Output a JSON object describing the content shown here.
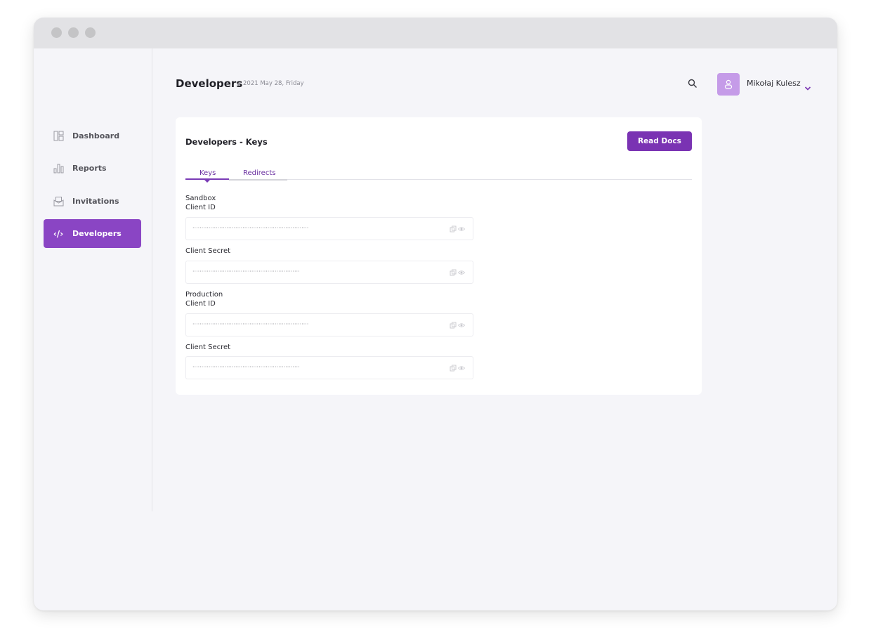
{
  "sidebar": {
    "items": [
      {
        "label": "Dashboard",
        "icon": "dashboard-icon"
      },
      {
        "label": "Reports",
        "icon": "bar-chart-icon"
      },
      {
        "label": "Invitations",
        "icon": "envelope-icon"
      },
      {
        "label": "Developers",
        "icon": "code-icon",
        "active": true
      }
    ]
  },
  "header": {
    "title": "Developers",
    "date": "2021 May 28, Friday",
    "user_name": "Mikołaj Kulesz"
  },
  "card": {
    "title": "Developers - Keys",
    "read_docs_label": "Read Docs",
    "tabs": [
      {
        "label": "Keys",
        "active": true
      },
      {
        "label": "Redirects",
        "active": false
      }
    ],
    "sandbox": {
      "section_label": "Sandbox",
      "client_id_label": "Client ID",
      "client_id_value": "·································································",
      "client_secret_label": "Client Secret",
      "client_secret_value": "····························································"
    },
    "production": {
      "section_label": "Production",
      "client_id_label": "Client ID",
      "client_id_value": "·································································",
      "client_secret_label": "Client Secret",
      "client_secret_value": "····························································"
    }
  },
  "colors": {
    "accent": "#8a45c4",
    "button": "#7a33b3",
    "avatar": "#c59be8",
    "background": "#f5f5f9"
  }
}
